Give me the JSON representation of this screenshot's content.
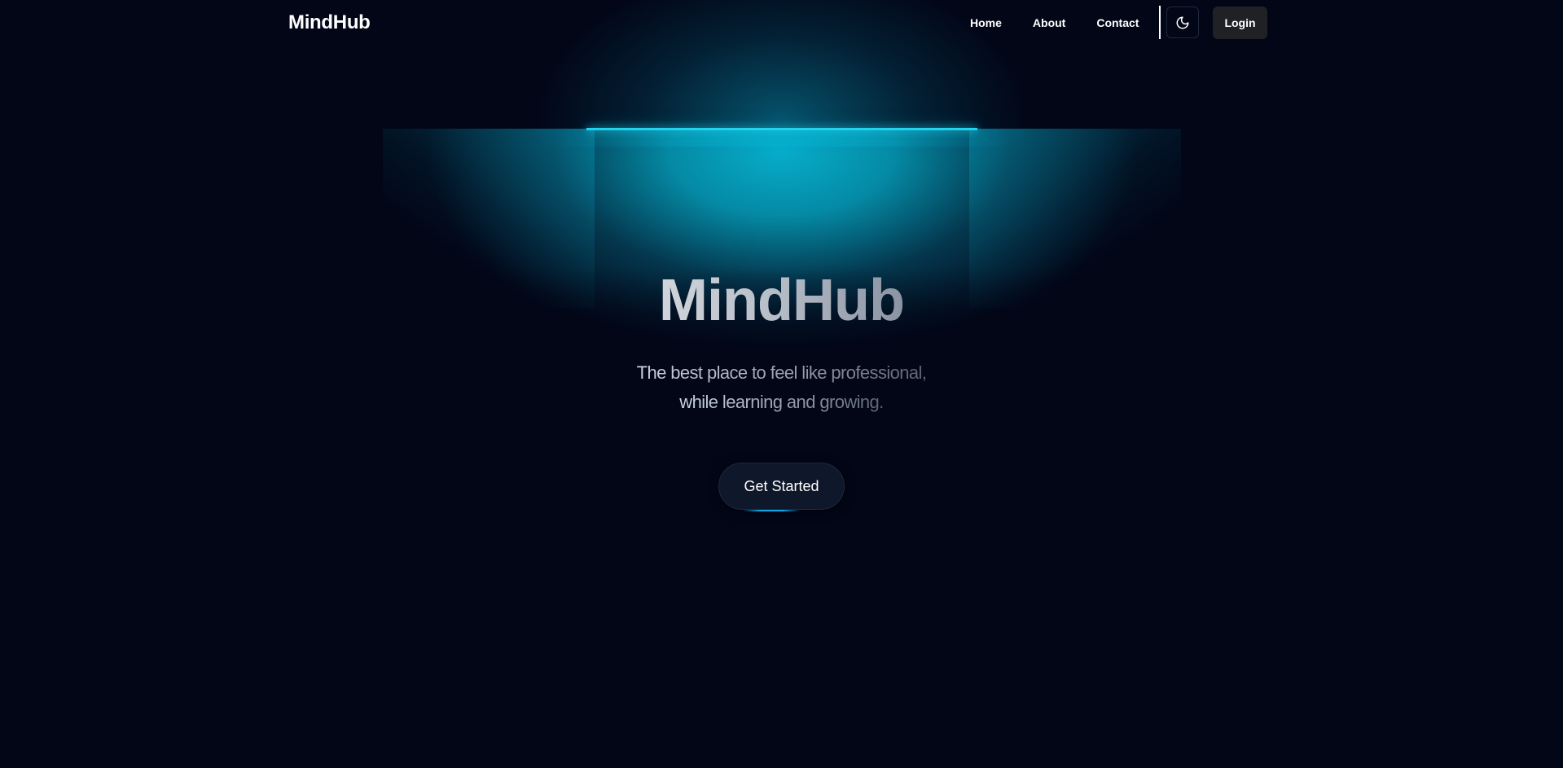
{
  "navbar": {
    "brand": "MindHub",
    "links": [
      "Home",
      "About",
      "Contact"
    ],
    "theme_toggle_icon": "moon-icon",
    "login_label": "Login"
  },
  "hero": {
    "title": "MindHub",
    "subtitle_line1": "The best place to feel like professional,",
    "subtitle_line2": "while learning and growing.",
    "cta_label": "Get Started"
  },
  "colors": {
    "background": "#020617",
    "accent_glow": "#06b6d4",
    "lamp_line": "#22d3ee",
    "cta_background": "#0f172a",
    "login_background": "#1f2125"
  }
}
